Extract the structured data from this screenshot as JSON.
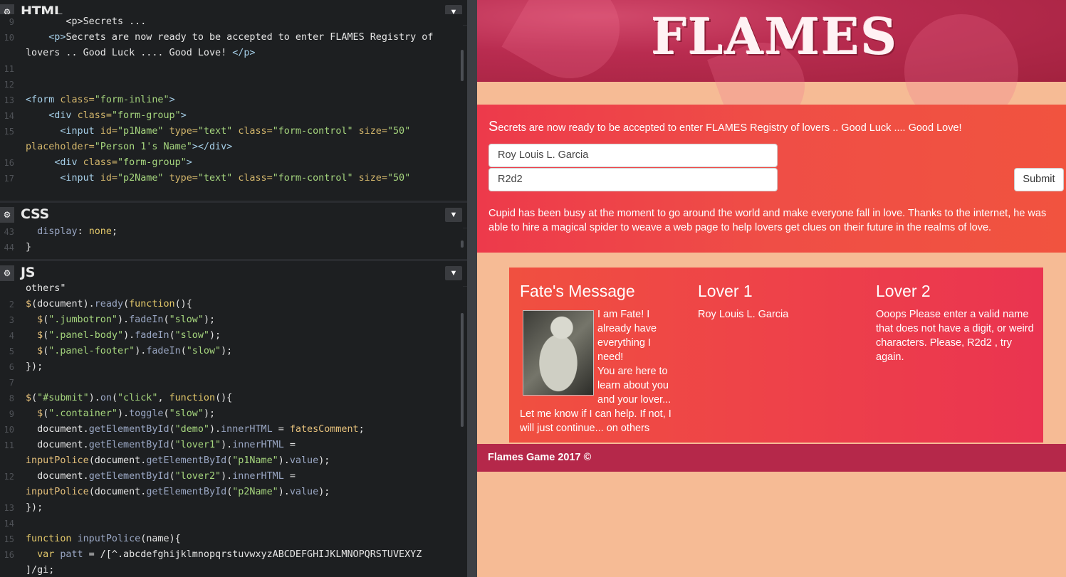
{
  "panels": {
    "html": {
      "title": "HTML"
    },
    "css": {
      "title": "CSS"
    },
    "js": {
      "title": "JS"
    }
  },
  "html_code": [
    {
      "n": "9",
      "segs": [
        [
          "pl",
          "       <p>Secrets ..."
        ]
      ]
    },
    {
      "n": "10",
      "segs": [
        [
          "pl",
          "    "
        ],
        [
          "tag",
          "<p>"
        ],
        [
          "pl",
          "Secrets are now ready to be accepted to enter FLAMES Registry of"
        ]
      ]
    },
    {
      "n": "",
      "segs": [
        [
          "pl",
          "lovers .. Good Luck .... Good Love! "
        ],
        [
          "tag",
          "</p>"
        ]
      ]
    },
    {
      "n": "11",
      "segs": []
    },
    {
      "n": "12",
      "segs": []
    },
    {
      "n": "13",
      "segs": [
        [
          "tag",
          "<form "
        ],
        [
          "attr",
          "class="
        ],
        [
          "str",
          "\"form-inline\""
        ],
        [
          "tag",
          ">"
        ]
      ]
    },
    {
      "n": "14",
      "segs": [
        [
          "pl",
          "    "
        ],
        [
          "tag",
          "<div "
        ],
        [
          "attr",
          "class="
        ],
        [
          "str",
          "\"form-group\""
        ],
        [
          "tag",
          ">"
        ]
      ]
    },
    {
      "n": "15",
      "segs": [
        [
          "pl",
          "      "
        ],
        [
          "tag",
          "<input "
        ],
        [
          "attr",
          "id="
        ],
        [
          "str",
          "\"p1Name\" "
        ],
        [
          "attr",
          "type="
        ],
        [
          "str",
          "\"text\" "
        ],
        [
          "attr",
          "class="
        ],
        [
          "str",
          "\"form-control\" "
        ],
        [
          "attr",
          "size="
        ],
        [
          "str",
          "\"50\""
        ]
      ]
    },
    {
      "n": "",
      "segs": [
        [
          "attr",
          "placeholder="
        ],
        [
          "str",
          "\"Person 1's Name\""
        ],
        [
          "tag",
          "></div>"
        ]
      ]
    },
    {
      "n": "16",
      "segs": [
        [
          "pl",
          "     "
        ],
        [
          "tag",
          "<div "
        ],
        [
          "attr",
          "class="
        ],
        [
          "str",
          "\"form-group\""
        ],
        [
          "tag",
          ">"
        ]
      ]
    },
    {
      "n": "17",
      "segs": [
        [
          "pl",
          "      "
        ],
        [
          "tag",
          "<input "
        ],
        [
          "attr",
          "id="
        ],
        [
          "str",
          "\"p2Name\" "
        ],
        [
          "attr",
          "type="
        ],
        [
          "str",
          "\"text\" "
        ],
        [
          "attr",
          "class="
        ],
        [
          "str",
          "\"form-control\" "
        ],
        [
          "attr",
          "size="
        ],
        [
          "str",
          "\"50\""
        ]
      ]
    }
  ],
  "css_code": [
    {
      "n": "43",
      "segs": [
        [
          "pl",
          "  "
        ],
        [
          "prop",
          "display"
        ],
        [
          "pl",
          ": "
        ],
        [
          "kw",
          "none"
        ],
        [
          "pl",
          ";"
        ]
      ]
    },
    {
      "n": "44",
      "segs": [
        [
          "pl",
          "}"
        ]
      ]
    }
  ],
  "js_code": [
    {
      "n": "",
      "segs": [
        [
          "pl",
          "others\""
        ]
      ]
    },
    {
      "n": "2",
      "segs": [
        [
          "fn",
          "$"
        ],
        [
          "pl",
          "("
        ],
        [
          "pl",
          "document"
        ],
        [
          "pl",
          ")."
        ],
        [
          "prop",
          "ready"
        ],
        [
          "pl",
          "("
        ],
        [
          "kw",
          "function"
        ],
        [
          "pl",
          "(){"
        ]
      ]
    },
    {
      "n": "3",
      "segs": [
        [
          "pl",
          "  "
        ],
        [
          "fn",
          "$"
        ],
        [
          "pl",
          "("
        ],
        [
          "str",
          "\".jumbotron\""
        ],
        [
          "pl",
          ")."
        ],
        [
          "prop",
          "fadeIn"
        ],
        [
          "pl",
          "("
        ],
        [
          "str",
          "\"slow\""
        ],
        [
          "pl",
          ");"
        ]
      ]
    },
    {
      "n": "4",
      "segs": [
        [
          "pl",
          "  "
        ],
        [
          "fn",
          "$"
        ],
        [
          "pl",
          "("
        ],
        [
          "str",
          "\".panel-body\""
        ],
        [
          "pl",
          ")."
        ],
        [
          "prop",
          "fadeIn"
        ],
        [
          "pl",
          "("
        ],
        [
          "str",
          "\"slow\""
        ],
        [
          "pl",
          ");"
        ]
      ]
    },
    {
      "n": "5",
      "segs": [
        [
          "pl",
          "  "
        ],
        [
          "fn",
          "$"
        ],
        [
          "pl",
          "("
        ],
        [
          "str",
          "\".panel-footer\""
        ],
        [
          "pl",
          ")."
        ],
        [
          "prop",
          "fadeIn"
        ],
        [
          "pl",
          "("
        ],
        [
          "str",
          "\"slow\""
        ],
        [
          "pl",
          ");"
        ]
      ]
    },
    {
      "n": "6",
      "segs": [
        [
          "pl",
          "});"
        ]
      ]
    },
    {
      "n": "7",
      "segs": []
    },
    {
      "n": "8",
      "segs": [
        [
          "fn",
          "$"
        ],
        [
          "pl",
          "("
        ],
        [
          "str",
          "\"#submit\""
        ],
        [
          "pl",
          ")."
        ],
        [
          "prop",
          "on"
        ],
        [
          "pl",
          "("
        ],
        [
          "str",
          "\"click\""
        ],
        [
          "pl",
          ", "
        ],
        [
          "kw",
          "function"
        ],
        [
          "pl",
          "(){"
        ]
      ]
    },
    {
      "n": "9",
      "segs": [
        [
          "pl",
          "  "
        ],
        [
          "fn",
          "$"
        ],
        [
          "pl",
          "("
        ],
        [
          "str",
          "\".container\""
        ],
        [
          "pl",
          ")."
        ],
        [
          "prop",
          "toggle"
        ],
        [
          "pl",
          "("
        ],
        [
          "str",
          "\"slow\""
        ],
        [
          "pl",
          ");"
        ]
      ]
    },
    {
      "n": "10",
      "segs": [
        [
          "pl",
          "  document."
        ],
        [
          "prop",
          "getElementById"
        ],
        [
          "pl",
          "("
        ],
        [
          "str",
          "\"demo\""
        ],
        [
          "pl",
          ")."
        ],
        [
          "prop",
          "innerHTML"
        ],
        [
          "pl",
          " = "
        ],
        [
          "fn",
          "fatesComment"
        ],
        [
          "pl",
          ";"
        ]
      ]
    },
    {
      "n": "11",
      "segs": [
        [
          "pl",
          "  document."
        ],
        [
          "prop",
          "getElementById"
        ],
        [
          "pl",
          "("
        ],
        [
          "str",
          "\"lover1\""
        ],
        [
          "pl",
          ")."
        ],
        [
          "prop",
          "innerHTML"
        ],
        [
          "pl",
          " ="
        ]
      ]
    },
    {
      "n": "",
      "segs": [
        [
          "fn",
          "inputPolice"
        ],
        [
          "pl",
          "(document."
        ],
        [
          "prop",
          "getElementById"
        ],
        [
          "pl",
          "("
        ],
        [
          "str",
          "\"p1Name\""
        ],
        [
          "pl",
          ")."
        ],
        [
          "prop",
          "value"
        ],
        [
          "pl",
          ");"
        ]
      ]
    },
    {
      "n": "12",
      "segs": [
        [
          "pl",
          "  document."
        ],
        [
          "prop",
          "getElementById"
        ],
        [
          "pl",
          "("
        ],
        [
          "str",
          "\"lover2\""
        ],
        [
          "pl",
          ")."
        ],
        [
          "prop",
          "innerHTML"
        ],
        [
          "pl",
          " ="
        ]
      ]
    },
    {
      "n": "",
      "segs": [
        [
          "fn",
          "inputPolice"
        ],
        [
          "pl",
          "(document."
        ],
        [
          "prop",
          "getElementById"
        ],
        [
          "pl",
          "("
        ],
        [
          "str",
          "\"p2Name\""
        ],
        [
          "pl",
          ")."
        ],
        [
          "prop",
          "value"
        ],
        [
          "pl",
          ");"
        ]
      ]
    },
    {
      "n": "13",
      "segs": [
        [
          "pl",
          "});"
        ]
      ]
    },
    {
      "n": "14",
      "segs": []
    },
    {
      "n": "15",
      "segs": [
        [
          "kw",
          "function "
        ],
        [
          "prop",
          "inputPolice"
        ],
        [
          "pl",
          "("
        ],
        [
          "pl",
          "name"
        ],
        [
          "pl",
          "){"
        ]
      ]
    },
    {
      "n": "16",
      "segs": [
        [
          "pl",
          "  "
        ],
        [
          "kw",
          "var "
        ],
        [
          "prop",
          "patt"
        ],
        [
          "pl",
          " = /[^.abcdefghijklmnopqrstuvwxyzABCDEFGHIJKLMNOPQRSTUVEXYZ"
        ]
      ]
    },
    {
      "n": "",
      "segs": [
        [
          "pl",
          "]/gi;"
        ]
      ]
    }
  ],
  "preview": {
    "logo": "FLAMES",
    "intro_first": "S",
    "intro_rest": "ecrets are now ready to be accepted to enter FLAMES Registry of lovers .. Good Luck .... Good Love!",
    "person1_value": "Roy Louis L. Garcia",
    "person2_value": "R2d2",
    "submit_label": "Submit",
    "about": "Cupid has been busy at the moment to go around the world and make everyone fall in love. Thanks to the internet, he was able to hire a magical spider to weave a web page to help lovers get clues on their future in the realms of love.",
    "fate_title": "Fate's Message",
    "fate_text": "I am Fate! I already have everything I need!\nYou are here to learn about you and your lover... Let me know if I can help. If not, I will just continue... on others",
    "lover1_title": "Lover 1",
    "lover1_text": "Roy Louis L. Garcia",
    "lover2_title": "Lover 2",
    "lover2_text": "Ooops Please enter a valid name that does not have a digit, or weird characters. Please, R2d2 , try again.",
    "footer": "Flames Game 2017 ©"
  }
}
